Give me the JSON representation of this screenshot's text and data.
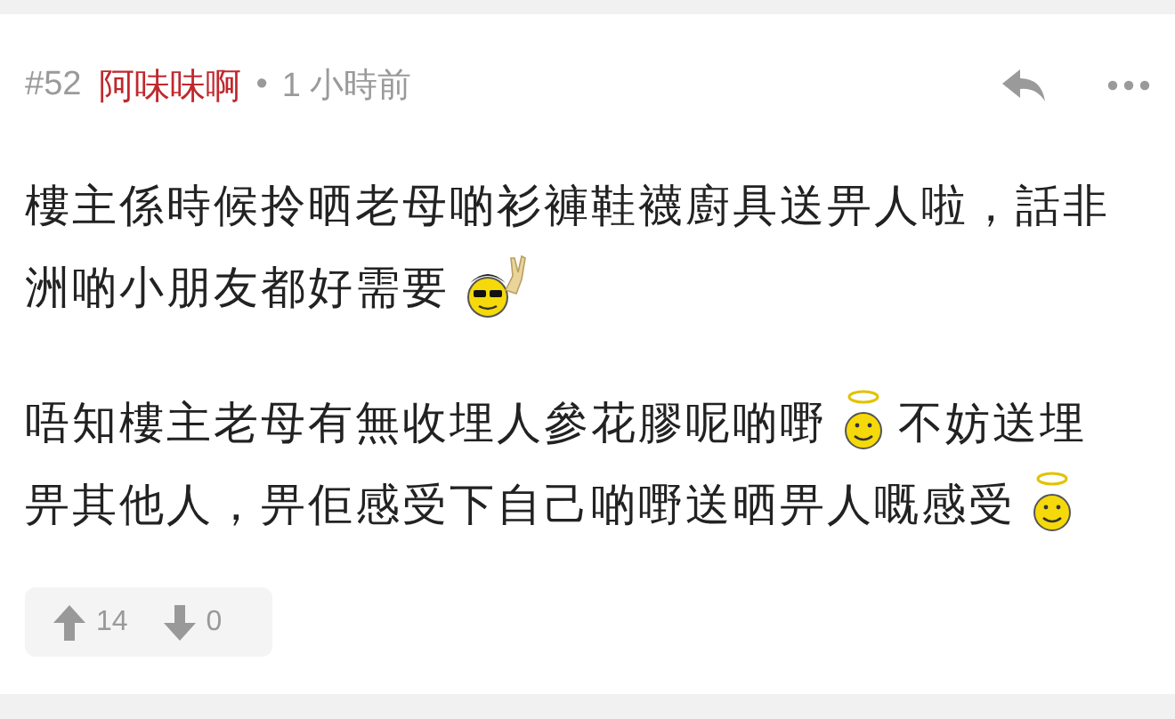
{
  "post": {
    "number": "#52",
    "author": "阿味味啊",
    "separator": "•",
    "time": "1 小時前"
  },
  "paragraphs": [
    {
      "lines": [
        [
          {
            "kind": "text",
            "text": "樓主係時候拎晒老母啲衫褲鞋襪廚具送畀人啦，話非"
          }
        ],
        [
          {
            "kind": "text",
            "text": "洲啲小朋友都好需要"
          },
          {
            "kind": "cool"
          }
        ]
      ]
    },
    {
      "lines": [
        [
          {
            "kind": "text",
            "text": "唔知樓主老母有無收埋人參花膠呢啲嘢"
          },
          {
            "kind": "angel"
          },
          {
            "kind": "text",
            "text": "不妨送埋"
          }
        ],
        [
          {
            "kind": "text",
            "text": "畀其他人，畀佢感受下自己啲嘢送晒畀人嘅感受"
          },
          {
            "kind": "angel"
          }
        ]
      ]
    }
  ],
  "votes": {
    "up": "14",
    "down": "0"
  }
}
